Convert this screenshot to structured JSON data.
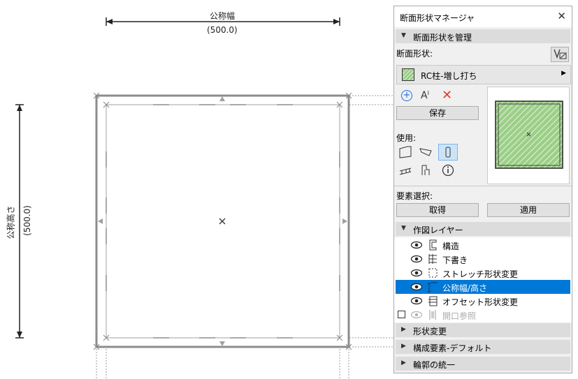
{
  "drawing": {
    "width_label": "公称幅",
    "width_value": "(500.0)",
    "height_label": "公称高さ",
    "height_value": "(500.0)"
  },
  "panel": {
    "title": "断面形状マネージャ",
    "manage_section": "断面形状を管理",
    "profile_label": "断面形状:",
    "profile_name": "RC柱-増し打ち",
    "save_button": "保存",
    "use_label": "使用:",
    "element_select_label": "要素選択:",
    "get_button": "取得",
    "apply_button": "適用",
    "layers_section": "作図レイヤー",
    "layers": [
      {
        "name": "構造",
        "icon": "structure-layer-icon"
      },
      {
        "name": "下書き",
        "icon": "draft-layer-icon"
      },
      {
        "name": "ストレッチ形状変更",
        "icon": "stretch-layer-icon"
      },
      {
        "name": "公称幅/高さ",
        "icon": "nominal-size-layer-icon"
      },
      {
        "name": "オフセット形状変更",
        "icon": "offset-layer-icon"
      },
      {
        "name": "開口参照",
        "icon": "opening-ref-layer-icon"
      }
    ],
    "shape_change_section": "形状変更",
    "component_default_section": "構成要素-デフォルト",
    "outline_section": "輪郭の統一",
    "accent_color": "#0078d7",
    "hatch_color": "#9ccf88"
  }
}
